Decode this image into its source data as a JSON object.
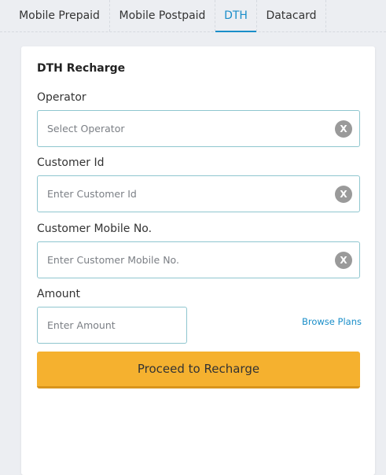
{
  "tabs": [
    {
      "label": "Mobile Prepaid",
      "active": false
    },
    {
      "label": "Mobile Postpaid",
      "active": false
    },
    {
      "label": "DTH",
      "active": true
    },
    {
      "label": "Datacard",
      "active": false
    }
  ],
  "form": {
    "title": "DTH Recharge",
    "operator": {
      "label": "Operator",
      "placeholder": "Select Operator",
      "clear_icon": "X"
    },
    "customer_id": {
      "label": "Customer Id",
      "placeholder": "Enter Customer Id",
      "clear_icon": "X"
    },
    "customer_mobile": {
      "label": "Customer Mobile No.",
      "placeholder": "Enter Customer Mobile No.",
      "clear_icon": "X"
    },
    "amount": {
      "label": "Amount",
      "placeholder": "Enter Amount"
    },
    "browse_plans": "Browse Plans",
    "submit_label": "Proceed to Recharge"
  },
  "colors": {
    "accent": "#1a8ec9",
    "button": "#f5b12f",
    "field_border": "#8fc6cf"
  }
}
